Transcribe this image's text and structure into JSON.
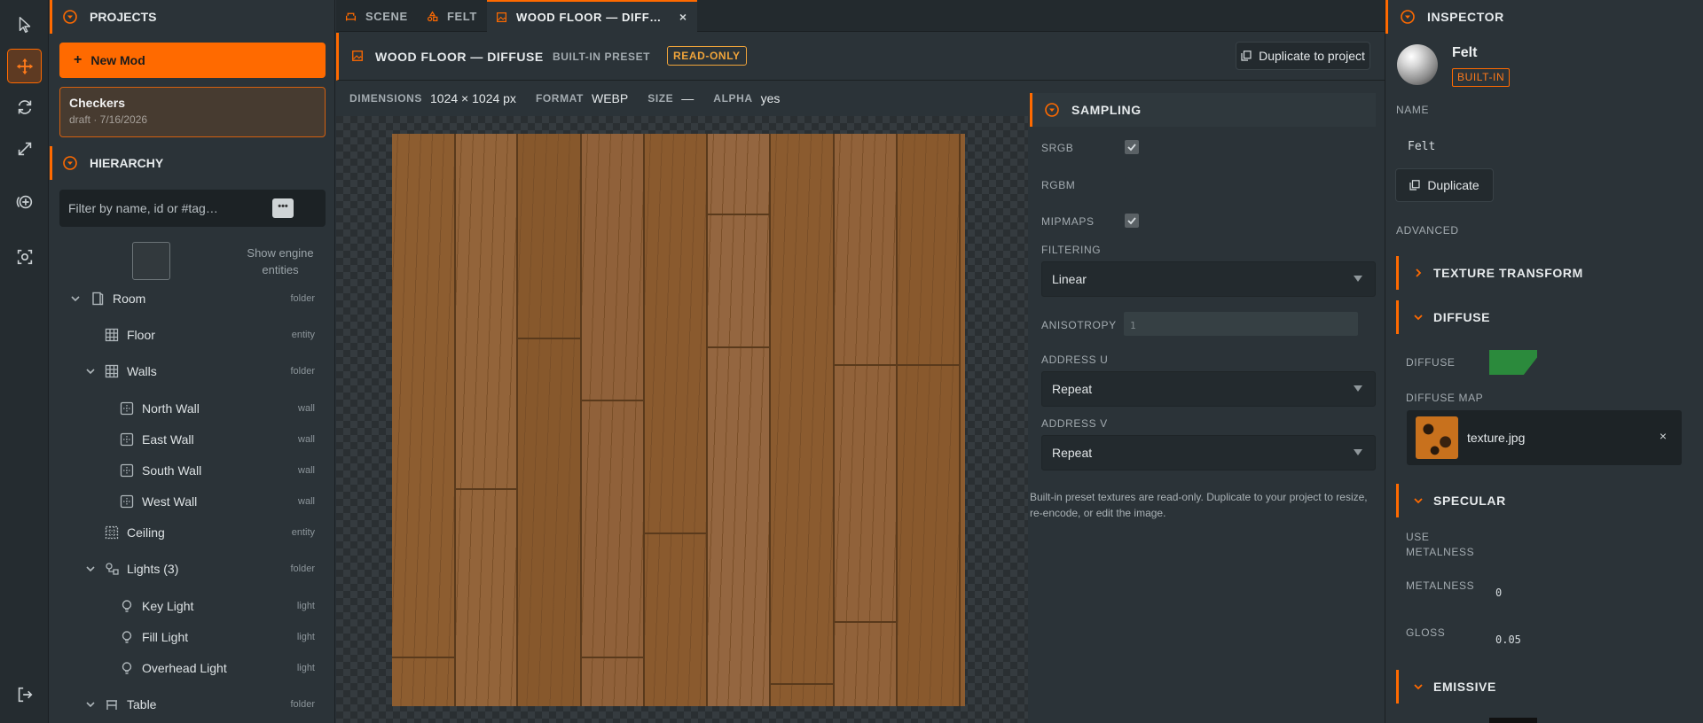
{
  "toolbar": {
    "tools": [
      "select-tool",
      "move-tool",
      "rotate-tool",
      "scale-tool",
      "add-entity-tool",
      "focus-tool",
      "exit-tool"
    ]
  },
  "projects": {
    "header": "PROJECTS",
    "new_mod_label": "New Mod",
    "card": {
      "title": "Checkers",
      "subtitle": "draft · 7/16/2026"
    }
  },
  "hierarchy": {
    "header": "HIERARCHY",
    "filter_placeholder": "Filter by name, id or #tag…",
    "more_label": "•••",
    "engine_label": "Show engine entities",
    "nodes": [
      {
        "label": "Room",
        "kind": "folder",
        "icon": "door-icon"
      },
      {
        "label": "Floor",
        "kind": "entity",
        "icon": "grid-icon"
      },
      {
        "label": "Walls",
        "kind": "folder",
        "icon": "grid-icon"
      },
      {
        "label": "North Wall",
        "kind": "wall",
        "icon": "wall-icon"
      },
      {
        "label": "East Wall",
        "kind": "wall",
        "icon": "wall-icon"
      },
      {
        "label": "South Wall",
        "kind": "wall",
        "icon": "wall-icon"
      },
      {
        "label": "West Wall",
        "kind": "wall",
        "icon": "wall-icon"
      },
      {
        "label": "Ceiling",
        "kind": "entity",
        "icon": "dotted-grid-icon"
      },
      {
        "label": "Lights (3)",
        "kind": "folder",
        "icon": "lights-icon"
      },
      {
        "label": "Key Light",
        "kind": "light",
        "icon": "bulb-icon"
      },
      {
        "label": "Fill Light",
        "kind": "light",
        "icon": "bulb-icon"
      },
      {
        "label": "Overhead Light",
        "kind": "light",
        "icon": "bulb-icon"
      },
      {
        "label": "Table",
        "kind": "folder",
        "icon": "table-icon"
      }
    ]
  },
  "tabs": [
    {
      "label": "SCENE",
      "icon": "sofa-icon"
    },
    {
      "label": "FELT",
      "icon": "shapes-icon"
    },
    {
      "label": "WOOD FLOOR — DIFF…",
      "icon": "image-icon",
      "close": "×"
    }
  ],
  "editor": {
    "title": "WOOD FLOOR — DIFFUSE",
    "preset": "BUILT-IN PRESET",
    "readonly": "READ-ONLY",
    "duplicate_label": "Duplicate to project",
    "meta": {
      "dimensions_key": "DIMENSIONS",
      "dimensions": "1024 × 1024 px",
      "format_key": "FORMAT",
      "format": "WEBP",
      "size_key": "SIZE",
      "size": "—",
      "alpha_key": "ALPHA",
      "alpha": "yes"
    }
  },
  "sampling": {
    "header": "SAMPLING",
    "srgb_label": "SRGB",
    "srgb": true,
    "rgbm_label": "RGBM",
    "rgbm": false,
    "mipmaps_label": "MIPMAPS",
    "mipmaps": true,
    "filtering_label": "FILTERING",
    "filtering": "Linear",
    "anisotropy_label": "ANISOTROPY",
    "anisotropy": "1",
    "address_u_label": "ADDRESS U",
    "address_u": "Repeat",
    "address_v_label": "ADDRESS V",
    "address_v": "Repeat",
    "note": "Built-in preset textures are read-only. Duplicate to your project to resize, re-encode, or edit the image."
  },
  "inspector": {
    "header": "INSPECTOR",
    "material_name": "Felt",
    "badge": "BUILT-IN",
    "name_label": "NAME",
    "name_value": "Felt",
    "duplicate_label": "Duplicate",
    "advanced_label": "ADVANCED",
    "sections": {
      "texture_transform": "TEXTURE TRANSFORM",
      "diffuse": "DIFFUSE",
      "specular": "SPECULAR",
      "emissive": "EMISSIVE"
    },
    "diffuse_label": "DIFFUSE",
    "diffuse_color": "#2b8a3c",
    "diffuse_map_label": "DIFFUSE MAP",
    "diffuse_map_file": "texture.jpg",
    "diffuse_map_clear": "×",
    "use_metalness_label": "USE METALNESS",
    "metalness_label": "METALNESS",
    "metalness": "0",
    "gloss_label": "GLOSS",
    "gloss": "0.05"
  },
  "colors": {
    "accent": "#ff6a00",
    "panel": "#2b3338",
    "toolbar": "#252c30"
  }
}
